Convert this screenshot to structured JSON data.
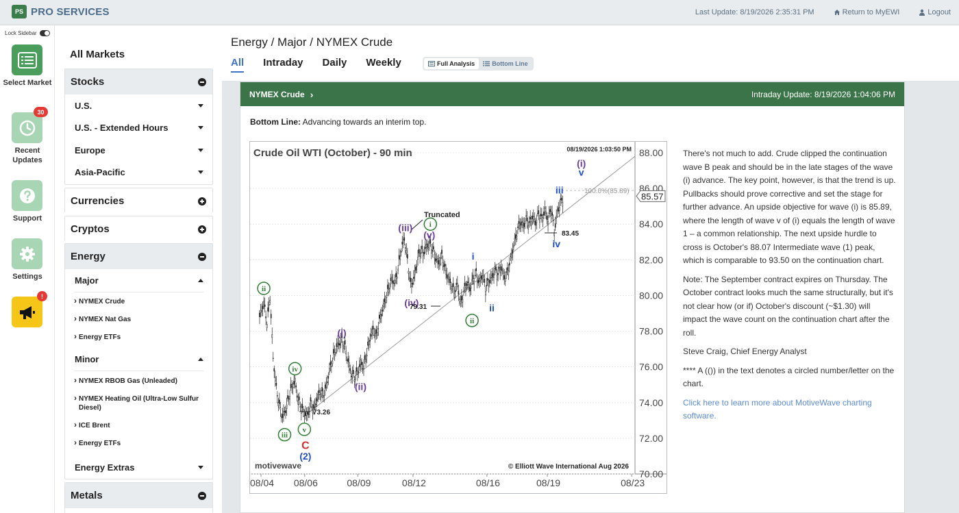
{
  "topbar": {
    "logo_mark": "PS",
    "logo_text": "PRO SERVICES",
    "last_update": "Last Update: 8/19/2026 2:35:31 PM",
    "return_label": "Return to MyEWI",
    "logout_label": "Logout"
  },
  "rail": {
    "lock_label": "Lock Sidebar",
    "select_market": "Select Market",
    "recent_updates": "Recent Updates",
    "recent_badge": "30",
    "support": "Support",
    "settings": "Settings",
    "alert_badge": "!"
  },
  "sidebar": {
    "all_markets": "All Markets",
    "stocks": {
      "label": "Stocks",
      "items": [
        "U.S.",
        "U.S. - Extended Hours",
        "Europe",
        "Asia-Pacific"
      ]
    },
    "currencies": "Currencies",
    "cryptos": "Cryptos",
    "energy": {
      "label": "Energy",
      "major": {
        "label": "Major",
        "items": [
          "NYMEX Crude",
          "NYMEX Nat Gas",
          "Energy ETFs"
        ]
      },
      "minor": {
        "label": "Minor",
        "items": [
          "NYMEX RBOB Gas (Unleaded)",
          "NYMEX Heating Oil (Ultra-Low Sulfur Diesel)",
          "ICE Brent",
          "Energy ETFs"
        ]
      },
      "extras": "Energy Extras"
    },
    "metals": "Metals"
  },
  "main": {
    "breadcrumb": "Energy / Major  / NYMEX Crude",
    "tabs": [
      "All",
      "Intraday",
      "Daily",
      "Weekly"
    ],
    "view_full": "Full Analysis",
    "view_bottom": "Bottom Line"
  },
  "card": {
    "title": "NYMEX Crude",
    "intraday_update": "Intraday Update: 8/19/2026 1:04:06 PM",
    "bottom_line_label": "Bottom Line:",
    "bottom_line_text": "Advancing towards an interim top."
  },
  "chart_data": {
    "type": "candlestick",
    "title": "Crude Oil WTI (October) - 90 min",
    "timestamp": "08/19/2026 1:03:50 PM",
    "watermark_left": "motivewave",
    "watermark_right": "© Elliott Wave International Aug 2026",
    "y_ticks": [
      "88.00",
      "86.00",
      "84.00",
      "82.00",
      "80.00",
      "78.00",
      "76.00",
      "74.00",
      "72.00",
      "70.00"
    ],
    "ylim": [
      70,
      88.5
    ],
    "x_ticks": [
      "08/04",
      "08/06",
      "08/09",
      "08/12",
      "08/16",
      "08/19",
      "08/23"
    ],
    "last_price": "85.57",
    "target_label": "100.0%(85.89)",
    "price_path": [
      [
        0,
        78.8
      ],
      [
        4,
        79.6
      ],
      [
        7,
        78.5
      ],
      [
        10,
        79.9
      ],
      [
        13,
        76.5
      ],
      [
        16,
        74.8
      ],
      [
        19,
        73.8
      ],
      [
        22,
        73.2
      ],
      [
        25,
        73.6
      ],
      [
        28,
        74.3
      ],
      [
        31,
        74.9
      ],
      [
        34,
        75.2
      ],
      [
        37,
        74.1
      ],
      [
        40,
        73.7
      ],
      [
        43,
        73.4
      ],
      [
        46,
        73.3
      ],
      [
        49,
        73.9
      ],
      [
        52,
        73.6
      ],
      [
        55,
        74.2
      ],
      [
        58,
        74.6
      ],
      [
        61,
        74.4
      ],
      [
        64,
        74.9
      ],
      [
        67,
        75.8
      ],
      [
        70,
        76.4
      ],
      [
        73,
        77.0
      ],
      [
        76,
        77.3
      ],
      [
        79,
        77.5
      ],
      [
        82,
        77.1
      ],
      [
        85,
        76.3
      ],
      [
        88,
        75.6
      ],
      [
        91,
        75.4
      ],
      [
        94,
        75.7
      ],
      [
        97,
        76.2
      ],
      [
        100,
        76.0
      ],
      [
        103,
        76.8
      ],
      [
        106,
        77.6
      ],
      [
        109,
        78.1
      ],
      [
        112,
        77.7
      ],
      [
        115,
        78.6
      ],
      [
        118,
        79.2
      ],
      [
        121,
        79.8
      ],
      [
        124,
        80.4
      ],
      [
        127,
        80.9
      ],
      [
        130,
        80.7
      ],
      [
        133,
        81.5
      ],
      [
        136,
        82.6
      ],
      [
        139,
        83.2
      ],
      [
        142,
        82.0
      ],
      [
        145,
        80.6
      ],
      [
        148,
        80.9
      ],
      [
        151,
        81.8
      ],
      [
        154,
        82.5
      ],
      [
        157,
        82.4
      ],
      [
        160,
        82.7
      ],
      [
        163,
        82.9
      ],
      [
        166,
        82.6
      ],
      [
        169,
        82.1
      ],
      [
        172,
        81.8
      ],
      [
        175,
        82.2
      ],
      [
        178,
        81.5
      ],
      [
        181,
        81.0
      ],
      [
        184,
        80.6
      ],
      [
        187,
        80.2
      ],
      [
        190,
        80.6
      ],
      [
        193,
        79.5
      ],
      [
        196,
        80.2
      ],
      [
        199,
        80.7
      ],
      [
        202,
        80.4
      ],
      [
        205,
        80.9
      ],
      [
        208,
        81.2
      ],
      [
        211,
        80.7
      ],
      [
        214,
        81.2
      ],
      [
        217,
        80.4
      ],
      [
        220,
        80.8
      ],
      [
        223,
        81.0
      ],
      [
        226,
        81.4
      ],
      [
        229,
        81.2
      ],
      [
        232,
        81.6
      ],
      [
        235,
        81.0
      ],
      [
        238,
        81.3
      ],
      [
        241,
        82.0
      ],
      [
        244,
        82.8
      ],
      [
        247,
        83.5
      ],
      [
        250,
        84.1
      ],
      [
        253,
        83.9
      ],
      [
        256,
        84.3
      ],
      [
        259,
        84.0
      ],
      [
        262,
        84.4
      ],
      [
        265,
        84.1
      ],
      [
        268,
        84.6
      ],
      [
        271,
        84.3
      ],
      [
        274,
        84.8
      ],
      [
        277,
        84.2
      ],
      [
        280,
        84.9
      ],
      [
        283,
        83.6
      ],
      [
        286,
        84.7
      ],
      [
        289,
        85.2
      ],
      [
        292,
        85.5
      ]
    ],
    "wave_labels": [
      {
        "text": "ii",
        "style": "circle-green",
        "price": 80.4,
        "bar": 4
      },
      {
        "text": "iv",
        "style": "circle-green",
        "price": 75.9,
        "bar": 34
      },
      {
        "text": "iii",
        "style": "circle-green",
        "price": 72.2,
        "bar": 24
      },
      {
        "text": "v",
        "style": "circle-green",
        "price": 72.5,
        "bar": 43
      },
      {
        "text": "C",
        "style": "red",
        "price": 71.6,
        "bar": 44
      },
      {
        "text": "(2)",
        "style": "blue",
        "price": 71.0,
        "bar": 44
      },
      {
        "text": "(i)",
        "style": "purple",
        "price": 77.9,
        "bar": 79
      },
      {
        "text": "(ii)",
        "style": "purple",
        "price": 74.9,
        "bar": 97
      },
      {
        "text": "(iii)",
        "style": "purple",
        "price": 83.8,
        "bar": 140
      },
      {
        "text": "(iv)",
        "style": "purple",
        "price": 79.6,
        "bar": 146
      },
      {
        "text": "(v)",
        "style": "purple",
        "price": 83.4,
        "bar": 163
      },
      {
        "text": "i",
        "style": "circle-green",
        "price": 84.0,
        "bar": 164
      },
      {
        "text": "i",
        "style": "blue",
        "price": 82.2,
        "bar": 205
      },
      {
        "text": "ii",
        "style": "circle-green",
        "price": 78.6,
        "bar": 204
      },
      {
        "text": "ii",
        "style": "blue",
        "price": 79.3,
        "bar": 223
      },
      {
        "text": "iii",
        "style": "blue",
        "price": 85.9,
        "bar": 288
      },
      {
        "text": "iv",
        "style": "blue",
        "price": 82.9,
        "bar": 285
      },
      {
        "text": "(i)",
        "style": "purple",
        "price": 87.4,
        "bar": 309
      },
      {
        "text": "v",
        "style": "blue",
        "price": 86.9,
        "bar": 309
      }
    ],
    "annotations": [
      "Truncated",
      "79.31",
      "73.26",
      "83.45"
    ]
  },
  "analysis": {
    "p1": "There's not much to add. Crude clipped the continuation wave B peak and should be in the late stages of the wave (i) advance. The key point, however, is that the trend is up. Pullbacks should prove corrective and set the stage for further advance. An upside objective for wave (i) is 85.89, where the length of wave v of (i) equals the length of wave 1 – a common relationship. The next upside hurdle to cross is October's 88.07 Intermediate wave (1) peak, which is comparable to 93.50 on the continuation chart.",
    "p2": "Note: The September contract expires on Thursday. The October contract looks much the same structurally, but it's not clear how (or if) October's discount (~$1.30) will impact the wave count on the continuation chart after the roll.",
    "p3": "Steve Craig, Chief Energy Analyst",
    "p4": "**** A (()) in the text denotes a circled number/letter on the chart.",
    "link": "Click here to learn more about MotiveWave charting software."
  },
  "colors": {
    "accent": "#3f72c7",
    "header_green": "#3b7448",
    "rail_green": "#4a9d5b"
  }
}
